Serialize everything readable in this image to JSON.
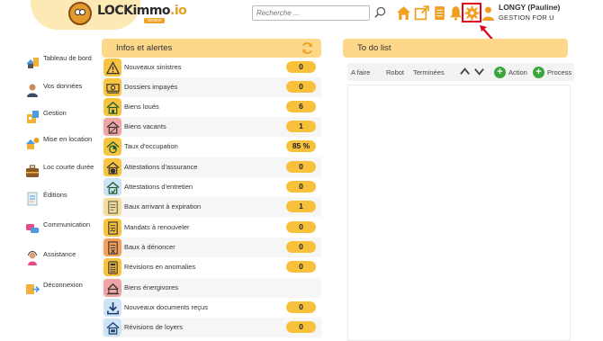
{
  "logo": {
    "text_main": "LOCKimmo",
    "text_suffix": ".io",
    "badge": "Version"
  },
  "search": {
    "placeholder": "Recherche ..."
  },
  "user": {
    "name": "LONGY (Pauline)",
    "org": "GESTION FOR U"
  },
  "colors": {
    "accent": "#fdd88b",
    "badge": "#f8c13c",
    "highlight": "#e0001a",
    "green": "#3ba53b"
  },
  "sidebar": {
    "items": [
      {
        "label": "Tableau de bord",
        "icon": "dashboard-icon"
      },
      {
        "label": "Vos données",
        "icon": "person-icon"
      },
      {
        "label": "Gestion",
        "icon": "management-icon"
      },
      {
        "label": "Mise en location",
        "icon": "rental-icon"
      },
      {
        "label": "Loc courte durée",
        "icon": "suitcase-icon"
      },
      {
        "label": "Éditions",
        "icon": "document-icon"
      },
      {
        "label": "Communication",
        "icon": "chat-icon"
      },
      {
        "label": "Assistance",
        "icon": "support-icon"
      },
      {
        "label": "Déconnexion",
        "icon": "logout-icon"
      }
    ]
  },
  "info": {
    "title": "Infos et alertes",
    "rows": [
      {
        "label": "Nouveaux sinistres",
        "count": "0",
        "icon": "warning-icon"
      },
      {
        "label": "Dossiers impayés",
        "count": "0",
        "icon": "money-icon"
      },
      {
        "label": "Biens loués",
        "count": "6",
        "icon": "house-key-icon"
      },
      {
        "label": "Biens vacants",
        "count": "1",
        "icon": "house-empty-icon"
      },
      {
        "label": "Taux d'occupation",
        "count": "85 %",
        "icon": "occupancy-icon"
      },
      {
        "label": "Attestations d'assurance",
        "count": "0",
        "icon": "insurance-icon"
      },
      {
        "label": "Attestations d'entretien",
        "count": "0",
        "icon": "maintenance-icon"
      },
      {
        "label": "Baux arrivant à expiration",
        "count": "1",
        "icon": "lease-expiry-icon"
      },
      {
        "label": "Mandats à renouveler",
        "count": "0",
        "icon": "mandate-icon"
      },
      {
        "label": "Baux à dénoncer",
        "count": "0",
        "icon": "lease-cancel-icon"
      },
      {
        "label": "Révisions en anomalies",
        "count": "0",
        "icon": "calculator-icon"
      },
      {
        "label": "Biens énergivores",
        "count": "",
        "icon": "energy-icon"
      },
      {
        "label": "Nouveaux documents reçus",
        "count": "0",
        "icon": "download-icon"
      },
      {
        "label": "Révisions de loyers",
        "count": "0",
        "icon": "rent-revision-icon"
      }
    ]
  },
  "todo": {
    "title": "To do list",
    "tabs": [
      "A faire",
      "Robot",
      "Terminées"
    ],
    "action_label": "Action",
    "process_label": "Process"
  }
}
